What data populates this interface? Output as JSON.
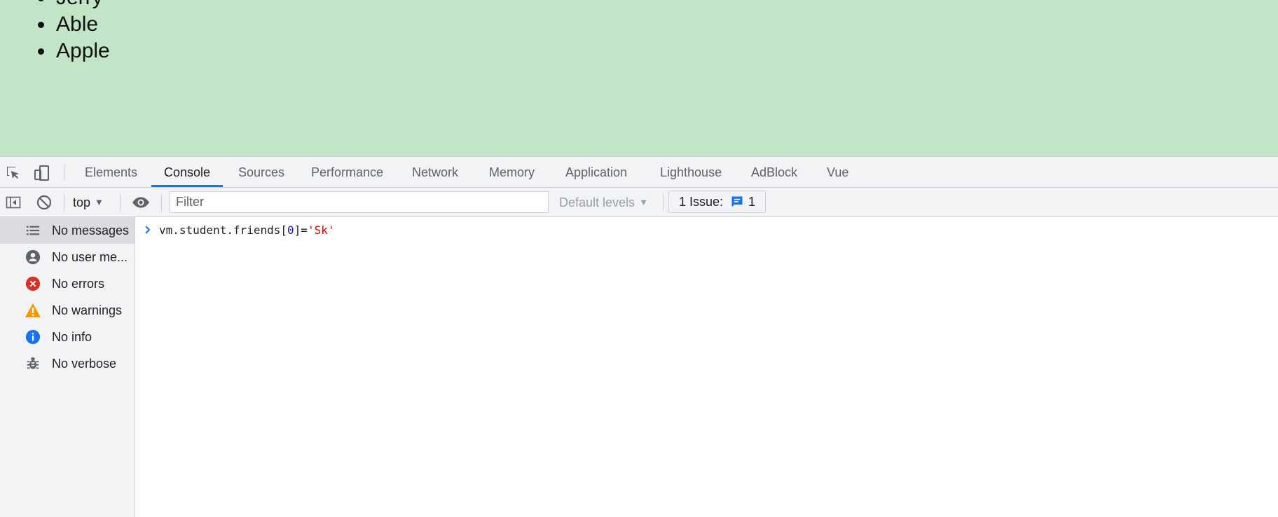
{
  "page": {
    "list_items": [
      "Jerry",
      "Able",
      "Apple"
    ]
  },
  "devtools": {
    "tabs": [
      {
        "label": "Elements"
      },
      {
        "label": "Console"
      },
      {
        "label": "Sources"
      },
      {
        "label": "Performance"
      },
      {
        "label": "Network"
      },
      {
        "label": "Memory"
      },
      {
        "label": "Application"
      },
      {
        "label": "Lighthouse"
      },
      {
        "label": "AdBlock"
      },
      {
        "label": "Vue"
      }
    ],
    "active_tab": "Console",
    "toolbar": {
      "context": "top",
      "filter_placeholder": "Filter",
      "levels": "Default levels",
      "issues_label": "1 Issue:",
      "issues_count": "1"
    },
    "sidebar": {
      "items": [
        {
          "label": "No messages",
          "icon": "list-icon"
        },
        {
          "label": "No user me...",
          "icon": "user-icon"
        },
        {
          "label": "No errors",
          "icon": "error-icon"
        },
        {
          "label": "No warnings",
          "icon": "warning-icon"
        },
        {
          "label": "No info",
          "icon": "info-icon"
        },
        {
          "label": "No verbose",
          "icon": "bug-icon"
        }
      ]
    },
    "console": {
      "input_pre": "vm.student.friends[",
      "input_num": "0",
      "input_mid": "]=",
      "input_str": "'Sk'"
    }
  },
  "colors": {
    "page_background": "#c3e5c7",
    "accent": "#1a73e8",
    "error": "#d93025",
    "warning": "#f29900",
    "info": "#1a73e8"
  }
}
